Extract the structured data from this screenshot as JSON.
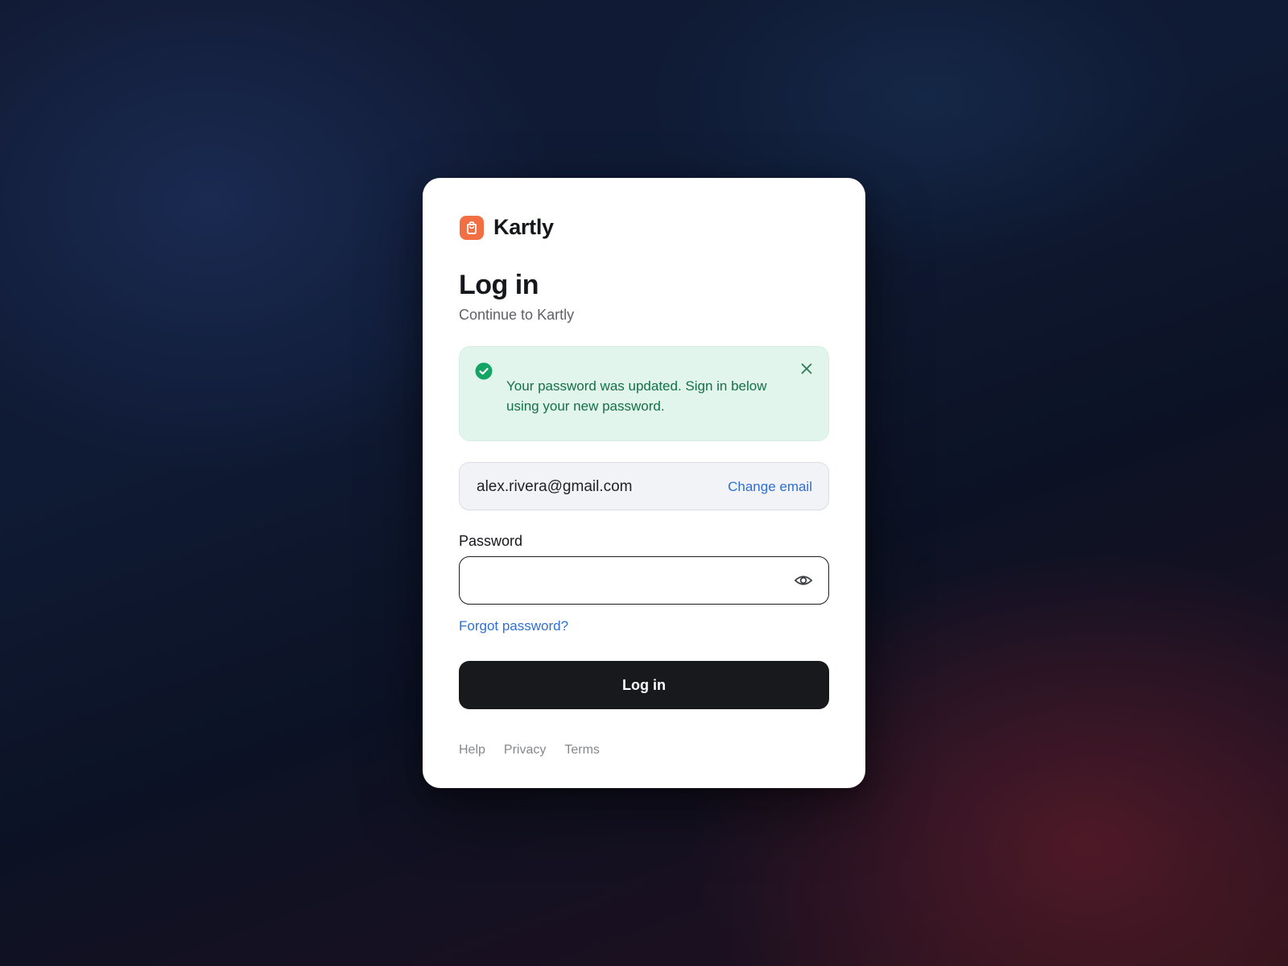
{
  "brand": {
    "name": "Kartly",
    "logo_icon": "shopping-bag-icon",
    "accent_color": "#f26f43"
  },
  "heading": {
    "title": "Log in",
    "subtitle": "Continue to Kartly"
  },
  "alert": {
    "type": "success",
    "icon": "check-circle-icon",
    "message": "Your password was updated. Sign in below using your new password.",
    "close_icon": "close-icon",
    "color": "#137047",
    "background": "#e2f5ec"
  },
  "email": {
    "value": "alex.rivera@gmail.com",
    "change_label": "Change email",
    "link_color": "#2f6fd6"
  },
  "password": {
    "label": "Password",
    "value": "",
    "toggle_icon": "eye-icon"
  },
  "forgot_label": "Forgot password?",
  "submit_label": "Log in",
  "footer": {
    "links": [
      "Help",
      "Privacy",
      "Terms"
    ]
  }
}
